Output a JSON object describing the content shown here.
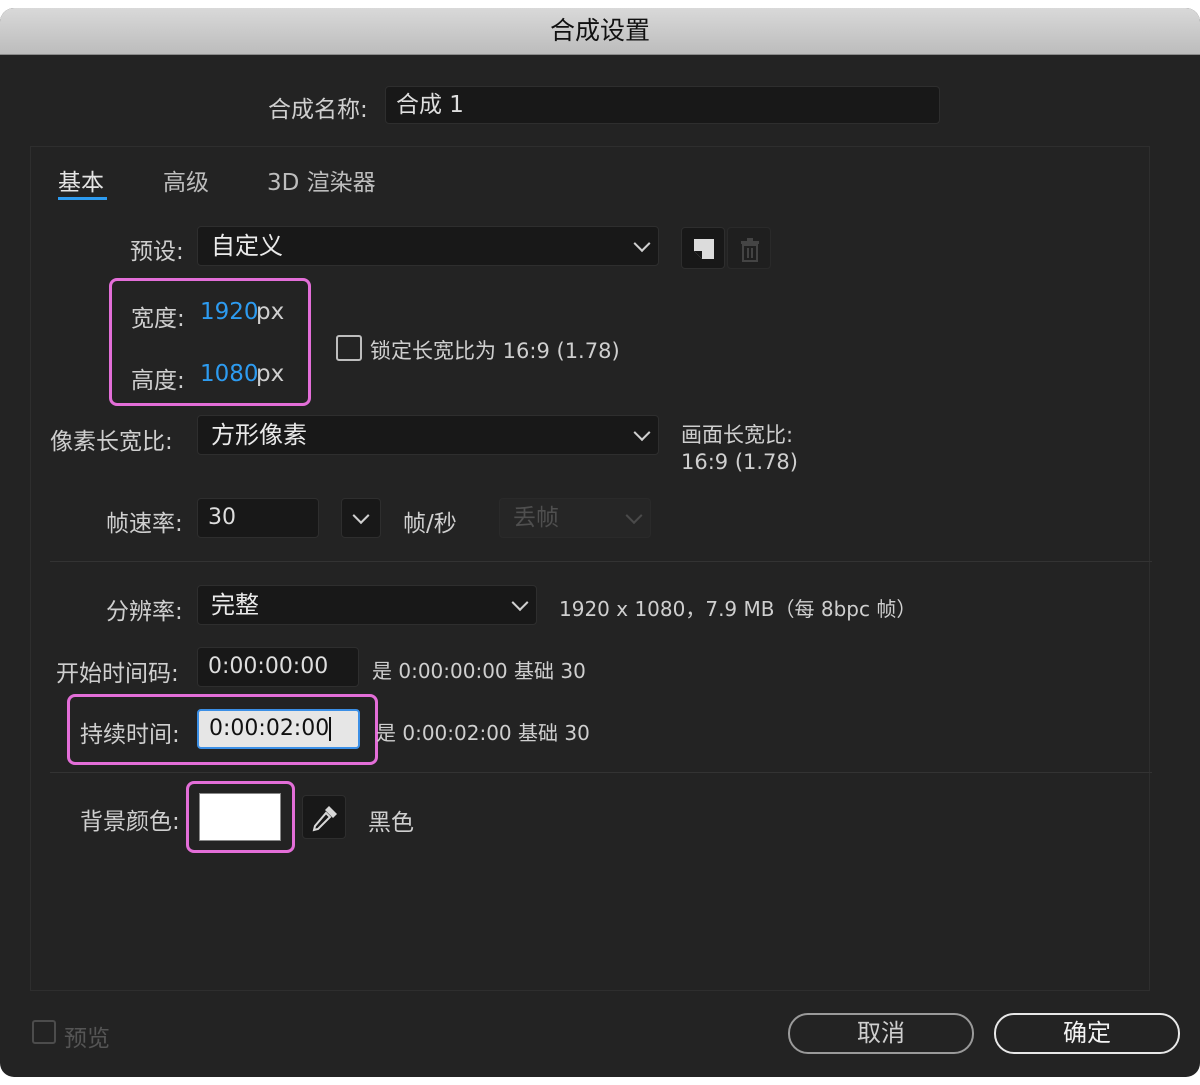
{
  "window": {
    "title": "合成设置"
  },
  "comp_name": {
    "label": "合成名称:",
    "value": "合成 1"
  },
  "tabs": [
    {
      "label": "基本",
      "active": true
    },
    {
      "label": "高级",
      "active": false
    },
    {
      "label": "3D 渲染器",
      "active": false
    }
  ],
  "preset": {
    "label": "预设:",
    "value": "自定义"
  },
  "width": {
    "label": "宽度:",
    "value": "1920",
    "unit": "px"
  },
  "height": {
    "label": "高度:",
    "value": "1080",
    "unit": "px"
  },
  "lock_aspect": {
    "label": "锁定长宽比为 16:9 (1.78)",
    "checked": false
  },
  "pixel_aspect": {
    "label": "像素长宽比:",
    "value": "方形像素"
  },
  "frame_aspect": {
    "label": "画面长宽比:",
    "value": "16:9 (1.78)"
  },
  "frame_rate": {
    "label": "帧速率:",
    "value": "30",
    "unit": "帧/秒",
    "drop_frame": "丢帧"
  },
  "resolution": {
    "label": "分辨率:",
    "value": "完整",
    "info": "1920 x 1080，7.9 MB（每 8bpc 帧）"
  },
  "start_timecode": {
    "label": "开始时间码:",
    "value": "0:00:00:00",
    "info": "是 0:00:00:00 基础 30"
  },
  "duration": {
    "label": "持续时间:",
    "value": "0:00:02:00",
    "info": "是 0:00:02:00 基础 30"
  },
  "background": {
    "label": "背景颜色:",
    "color": "#ffffff",
    "name": "黑色"
  },
  "footer": {
    "preview_label": "预览",
    "cancel_label": "取消",
    "ok_label": "确定"
  },
  "colors": {
    "accent_blue": "#2d9bf0",
    "highlight": "#e36ed8",
    "bg": "#232323"
  }
}
